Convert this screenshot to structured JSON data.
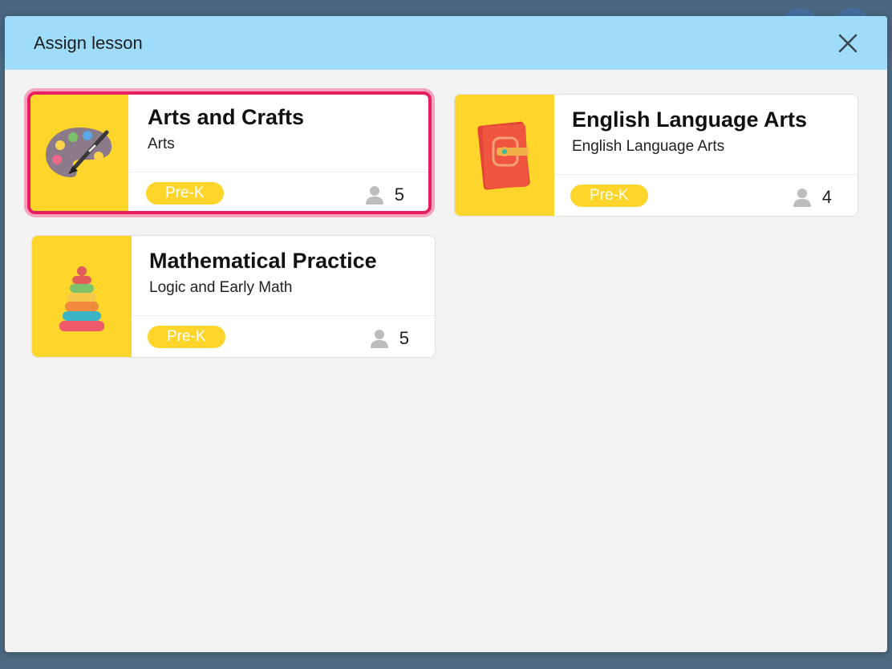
{
  "modal": {
    "title": "Assign lesson"
  },
  "lessons": [
    {
      "title": "Arts and Crafts",
      "subtitle": "Arts",
      "grade": "Pre-K",
      "students": "5",
      "icon": "palette-icon",
      "selected": true
    },
    {
      "title": "English Language Arts",
      "subtitle": "English Language Arts",
      "grade": "Pre-K",
      "students": "4",
      "icon": "book-icon",
      "selected": false
    },
    {
      "title": "Mathematical Practice",
      "subtitle": "Logic and Early Math",
      "grade": "Pre-K",
      "students": "5",
      "icon": "stacking-rings-icon",
      "selected": false
    }
  ],
  "colors": {
    "header": "#9edcfa",
    "thumb": "#fdd52b",
    "selection": "#e81f5f"
  }
}
